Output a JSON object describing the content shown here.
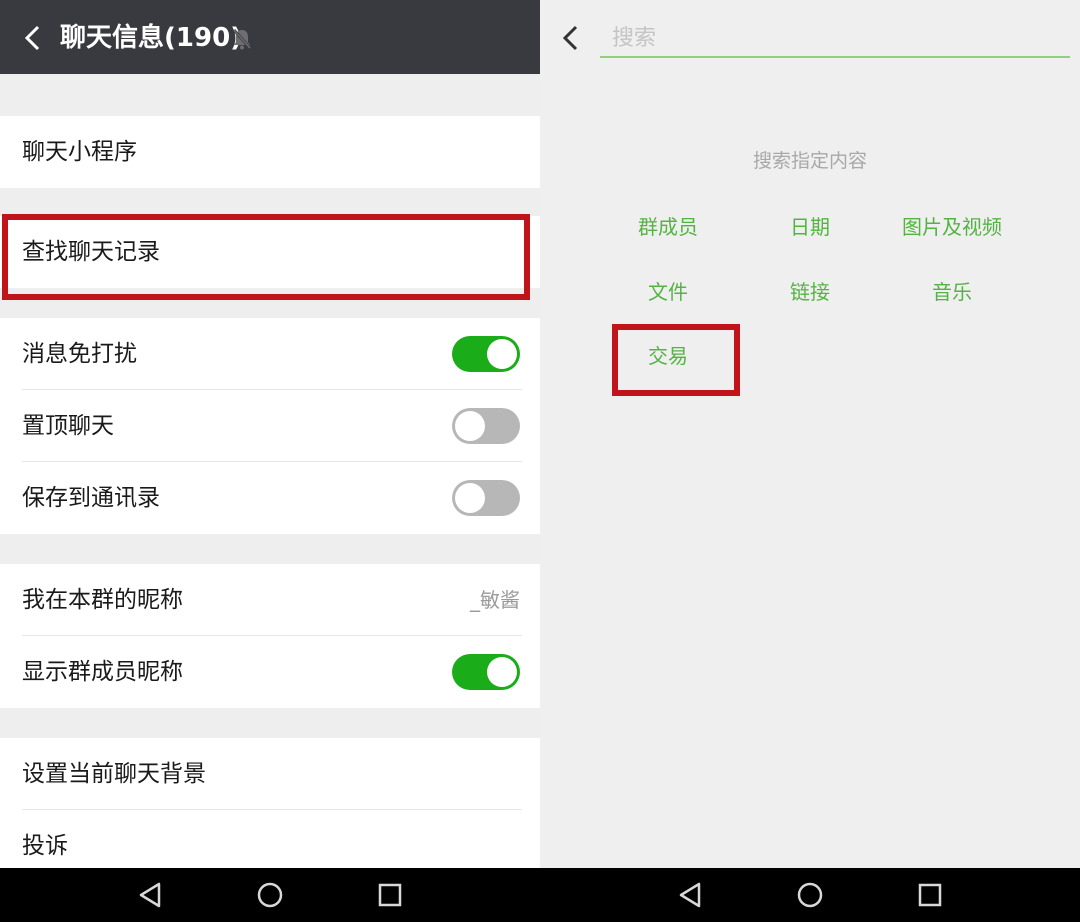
{
  "left": {
    "header": {
      "title": "聊天信息(190)",
      "back_icon": "back-chevron-icon",
      "mute_icon": "bell-muted-icon"
    },
    "rows": [
      {
        "label": "聊天小程序"
      },
      {
        "label": "查找聊天记录"
      },
      {
        "label": "消息免打扰",
        "toggle": "on"
      },
      {
        "label": "置顶聊天",
        "toggle": "off"
      },
      {
        "label": "保存到通讯录",
        "toggle": "off"
      },
      {
        "label": "我在本群的昵称",
        "value": "_敏酱"
      },
      {
        "label": "显示群成员昵称",
        "toggle": "on"
      },
      {
        "label": "设置当前聊天背景"
      },
      {
        "label": "投诉"
      }
    ]
  },
  "right": {
    "search": {
      "placeholder": "搜索",
      "value": ""
    },
    "hint": "搜索指定内容",
    "options": [
      "群成员",
      "日期",
      "图片及视频",
      "文件",
      "链接",
      "音乐",
      "交易"
    ]
  },
  "nav": {
    "icons": [
      "nav-back-icon",
      "nav-home-icon",
      "nav-recents-icon"
    ]
  },
  "colors": {
    "accent": "#1aad19",
    "highlight": "#c0141a",
    "header": "#393a3f",
    "option_text": "#55b344"
  }
}
